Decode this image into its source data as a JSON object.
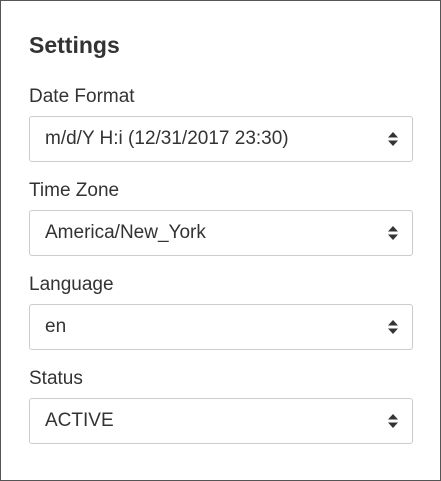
{
  "settings": {
    "title": "Settings",
    "fields": [
      {
        "label": "Date Format",
        "value": "m/d/Y H:i (12/31/2017 23:30)"
      },
      {
        "label": "Time Zone",
        "value": "America/New_York"
      },
      {
        "label": "Language",
        "value": "en"
      },
      {
        "label": "Status",
        "value": "ACTIVE"
      }
    ]
  },
  "icons": {
    "select_caret": "up-down-caret-icon"
  },
  "colors": {
    "text": "#333333",
    "border": "#cccccc",
    "panel_border": "#555555",
    "background": "#ffffff"
  }
}
